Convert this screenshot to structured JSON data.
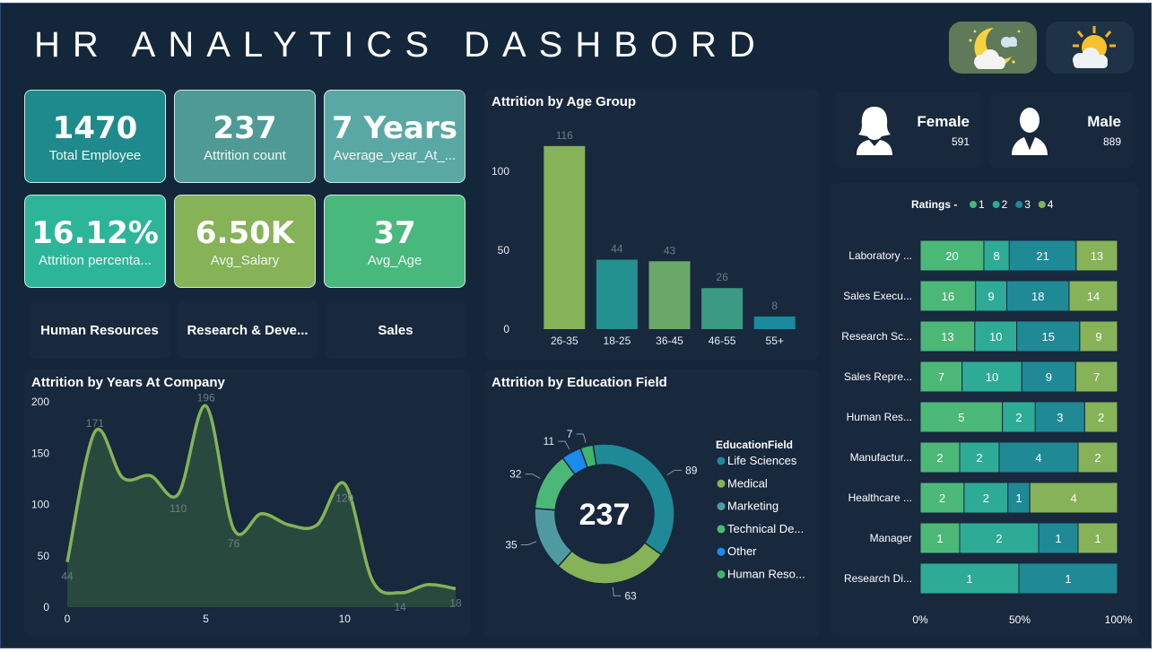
{
  "title": "HR ANALYTICS DASHBORD",
  "kpis": [
    {
      "value": "1470",
      "label": "Total Employee",
      "color": "#1e8a8c"
    },
    {
      "value": "237",
      "label": "Attrition count",
      "color": "#4f9a94"
    },
    {
      "value": "7 Years",
      "label": "Average_year_At_...",
      "color": "#5aa8a4"
    },
    {
      "value": "16.12%",
      "label": "Attrition percenta...",
      "color": "#2db59a"
    },
    {
      "value": "6.50K",
      "label": "Avg_Salary",
      "color": "#86b258"
    },
    {
      "value": "37",
      "label": "Avg_Age",
      "color": "#48b87c"
    }
  ],
  "departments": [
    "Human Resources",
    "Research & Deve...",
    "Sales"
  ],
  "gender": {
    "female_label": "Female",
    "female_value": "591",
    "male_label": "Male",
    "male_value": "889"
  },
  "age_chart": {
    "title": "Attrition by Age Group"
  },
  "years_chart": {
    "title": "Attrition by Years At Company"
  },
  "edu_chart": {
    "title": "Attrition by Education Field",
    "center": "237",
    "legend_title": "EducationField"
  },
  "ratings": {
    "title": "Ratings",
    "axis": [
      "0%",
      "50%",
      "100%"
    ]
  },
  "chart_data": [
    {
      "type": "bar",
      "title": "Attrition by Age Group",
      "categories": [
        "26-35",
        "18-25",
        "36-45",
        "46-55",
        "55+"
      ],
      "values": [
        116,
        44,
        43,
        26,
        8
      ],
      "colors": [
        "#86b258",
        "#239090",
        "#6aa86a",
        "#3a9a84",
        "#1a8a9c"
      ],
      "yticks": [
        0,
        50,
        100
      ],
      "ylim": [
        0,
        125
      ]
    },
    {
      "type": "area",
      "title": "Attrition by Years At Company",
      "x": [
        0,
        1,
        2,
        3,
        4,
        5,
        6,
        7,
        8,
        9,
        10,
        11,
        12,
        13,
        14
      ],
      "y": [
        44,
        171,
        126,
        128,
        110,
        196,
        76,
        91,
        80,
        80,
        120,
        26,
        14,
        22,
        18
      ],
      "labels": {
        "0": "44",
        "1": "171",
        "4": "110",
        "5": "196",
        "6": "76",
        "10": "120",
        "12": "14",
        "14": "18"
      },
      "yticks": [
        0,
        50,
        100,
        150,
        200
      ],
      "xticks": [
        0,
        5,
        10
      ],
      "ylim": [
        0,
        200
      ],
      "xlim": [
        0,
        14
      ]
    },
    {
      "type": "pie",
      "title": "Attrition by Education Field",
      "slices": [
        {
          "name": "Life Sciences",
          "value": 89,
          "color": "#1f8a96"
        },
        {
          "name": "Medical",
          "value": 63,
          "color": "#86b258"
        },
        {
          "name": "Marketing",
          "value": 35,
          "color": "#4f9aa0"
        },
        {
          "name": "Technical De...",
          "value": 32,
          "color": "#4bb878"
        },
        {
          "name": "Other",
          "value": 11,
          "color": "#1a8cf0"
        },
        {
          "name": "Human Reso...",
          "value": 7,
          "color": "#41b36a"
        }
      ]
    },
    {
      "type": "bar",
      "title": "Ratings",
      "stacked": "100%",
      "series_names": [
        "1",
        "2",
        "3",
        "4"
      ],
      "series_colors": [
        "#4bb878",
        "#2eab96",
        "#1f8a96",
        "#86b258"
      ],
      "categories": [
        "Laboratory ...",
        "Sales Execu...",
        "Research Sc...",
        "Sales Repre...",
        "Human Res...",
        "Manufactur...",
        "Healthcare ...",
        "Manager",
        "Research Di..."
      ],
      "rows": [
        [
          20,
          8,
          21,
          13
        ],
        [
          16,
          9,
          18,
          14
        ],
        [
          13,
          10,
          15,
          9
        ],
        [
          7,
          10,
          9,
          7
        ],
        [
          5,
          2,
          3,
          2
        ],
        [
          2,
          2,
          4,
          2
        ],
        [
          2,
          2,
          1,
          4
        ],
        [
          1,
          2,
          1,
          1
        ],
        [
          0,
          1,
          1,
          0
        ]
      ]
    }
  ]
}
